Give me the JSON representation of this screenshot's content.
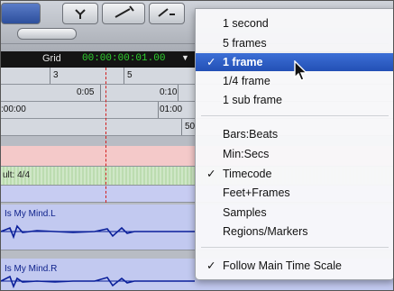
{
  "toolbar": {
    "buttons": [
      "edit-mode-button-a",
      "edit-mode-button-b",
      "edit-mode-button-c",
      "edit-mode-button-d"
    ]
  },
  "grid": {
    "label": "Grid",
    "value": "00:00:00:01.00",
    "arrow": "▼"
  },
  "ruler_bars": {
    "marks": [
      "3",
      "5"
    ]
  },
  "ruler_minsecs": {
    "marks": [
      "0:05",
      "0:10"
    ]
  },
  "ruler_timecode": {
    "marks": [
      ":00:00",
      "01:00"
    ]
  },
  "ruler_samples": {
    "marks": [
      "50"
    ]
  },
  "meter_track": {
    "label": "ult: 4/4"
  },
  "audio_tracks": [
    {
      "name": "Is My Mind.L"
    },
    {
      "name": "Is My Mind.R"
    }
  ],
  "menu": {
    "items": [
      {
        "label": "1 second",
        "checked": false
      },
      {
        "label": "5 frames",
        "checked": false
      },
      {
        "label": "1 frame",
        "checked": true,
        "selected": true
      },
      {
        "label": "1/4 frame",
        "checked": false
      },
      {
        "label": "1 sub frame",
        "checked": false
      },
      {
        "label": "Bars:Beats",
        "checked": false
      },
      {
        "label": "Min:Secs",
        "checked": false
      },
      {
        "label": "Timecode",
        "checked": true
      },
      {
        "label": "Feet+Frames",
        "checked": false
      },
      {
        "label": "Samples",
        "checked": false
      },
      {
        "label": "Regions/Markers",
        "checked": false
      },
      {
        "label": "Follow Main Time Scale",
        "checked": true
      }
    ],
    "check_glyph": "✓"
  },
  "colors": {
    "selected": "#2350b5",
    "grid_value": "#2fd22f",
    "playhead": "#d21c1c",
    "waveform": "#0a1f9a"
  }
}
